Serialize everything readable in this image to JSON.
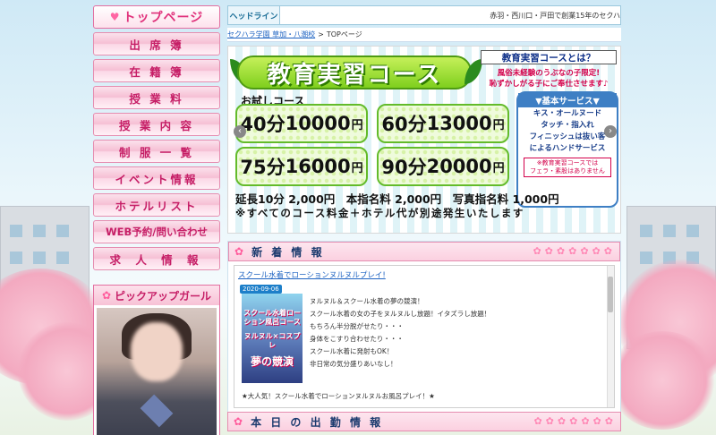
{
  "menu": {
    "top": "トップページ",
    "items": [
      "出 席 簿",
      "在 籍 簿",
      "授 業 料",
      "授 業 内 容",
      "制 服 一 覧",
      "イベント情報",
      "ホテルリスト",
      "WEB予約/問い合わせ",
      "求 人 情 報"
    ]
  },
  "pickup": {
    "title": "ピックアップガール"
  },
  "headline": {
    "label": "ヘッドライン",
    "text": "赤羽・西川口・戸田で創業15年のセクハ"
  },
  "breadcrumb": {
    "link": "セクハラ学園 草加・八潮校",
    "sep": ">",
    "current": "TOPページ"
  },
  "banner": {
    "title": "教育実習コース",
    "trial": "お試しコース",
    "prices": [
      {
        "time": "40分",
        "price": "10000",
        "unit": "円"
      },
      {
        "time": "60分",
        "price": "13000",
        "unit": "円"
      },
      {
        "time": "75分",
        "price": "16000",
        "unit": "円"
      },
      {
        "time": "90分",
        "price": "20000",
        "unit": "円"
      }
    ],
    "sub_title": "教育実習コースとは？",
    "sub_desc_1": "風俗未経験のうぶなの子限定!",
    "sub_desc_2": "恥ずかしがる子にご奉仕させます♪",
    "service_head": "▼基本サービス▼",
    "service_lines": [
      "キス・オールヌード",
      "タッチ・指入れ",
      "フィニッシュは抜い客",
      "によるハンドサービス"
    ],
    "service_note": "※教育実習コースでは\nフェラ・素股はありません",
    "extras": "延長10分 2,000円　本指名料 2,000円　写真指名料 1,000円",
    "notice": "※すべてのコース料金＋ホテル代が別途発生いたします",
    "arrow_left": "‹",
    "arrow_right": "›"
  },
  "news": {
    "head": "新 着 情 報",
    "title": "スクール水着でローションヌルヌルプレイ!",
    "date": "2020-09-06",
    "thumb_top": "スクール水着ローション風呂コース",
    "thumb_mid": "ヌルヌル×コスプレ",
    "thumb_main": "夢の競演",
    "lines": [
      "ヌルヌル＆スクール水着の夢の競演！",
      "スクール水着の女の子をヌルヌルし放題！イタズラし放題！",
      "もちろん半分脱がせたり・・・",
      "身体をこすり合わせたり・・・",
      "スクール水着に発射もOK！",
      "非日常の気分盛りあいなし！"
    ],
    "footer": "★大人気！スクール水着でローションヌルヌルお風呂プレイ！★"
  },
  "today": {
    "head": "本 日 の 出 勤 情 報"
  }
}
